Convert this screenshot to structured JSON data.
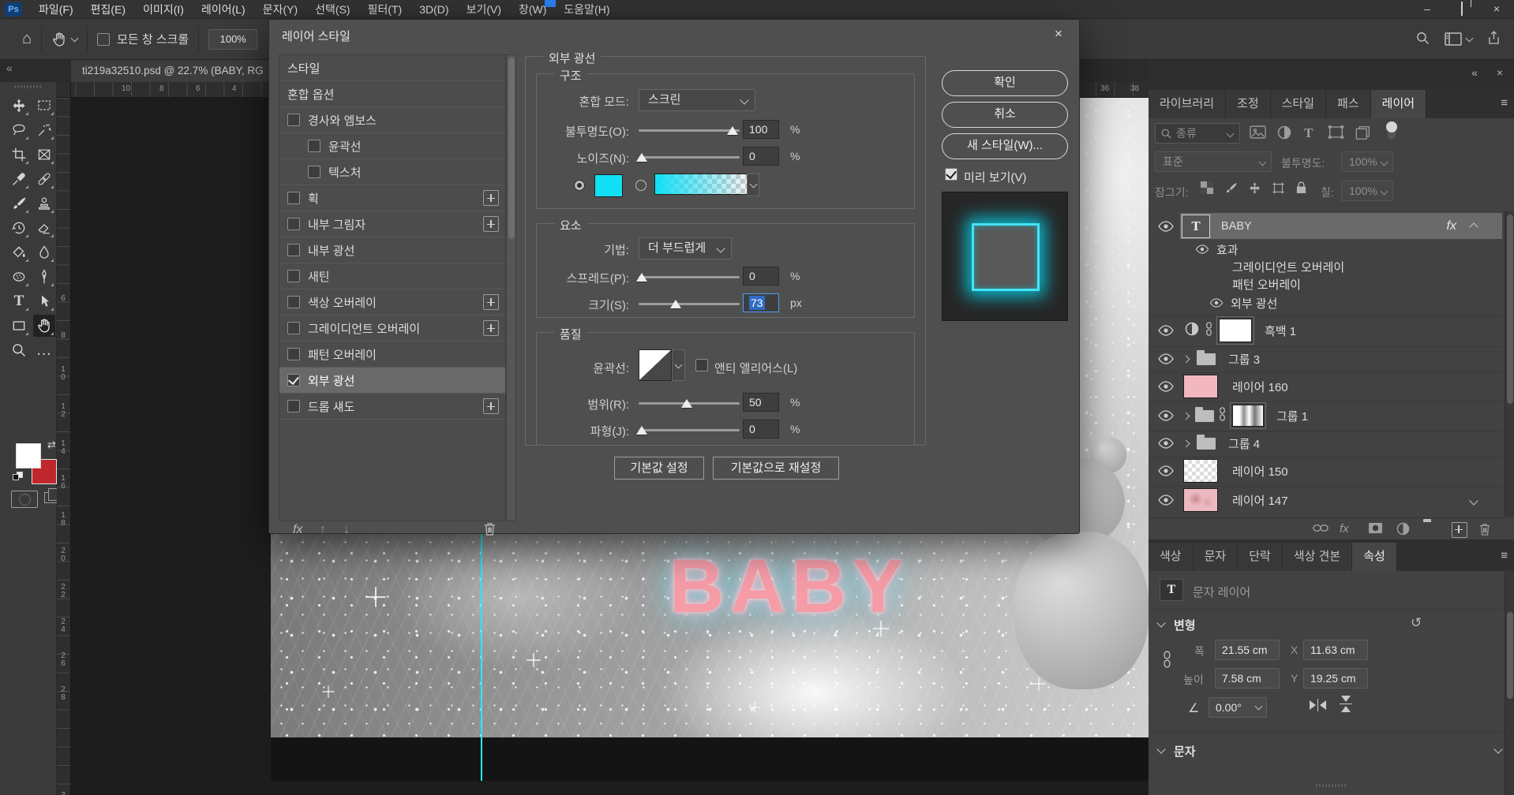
{
  "chrome": {
    "logo": "Ps",
    "menus": [
      "파일(F)",
      "편집(E)",
      "이미지(I)",
      "레이어(L)",
      "문자(Y)",
      "선택(S)",
      "필터(T)",
      "3D(D)",
      "보기(V)",
      "창(W)",
      "도움말(H)"
    ]
  },
  "glyphs": {
    "home": "⌂",
    "swap": "⇄",
    "reset": "↺",
    "angle": "∠",
    "more": "…",
    "collapse_left": "«",
    "hamburger": "≡",
    "minimize": "–",
    "close": "×",
    "up_arrow": "↑",
    "down_arrow": "↓"
  },
  "options_bar": {
    "scroll_all_windows_label": "모든 창 스크롤",
    "zoom_value": "100%"
  },
  "tab_bar": {
    "doc_title": "ti219a32510.psd @ 22.7% (BABY, RG"
  },
  "rulers": {
    "h": [
      "10",
      "8",
      "6",
      "4",
      "36",
      "38"
    ],
    "v": [
      "6",
      "8",
      "10",
      "12",
      "14",
      "16",
      "18",
      "20",
      "22",
      "24",
      "26",
      "28",
      "3"
    ]
  },
  "canvas": {
    "text": "BABY"
  },
  "dialog": {
    "title": "레이어 스타일",
    "list": {
      "header": "스타일",
      "blending": "혼합 옵션",
      "items": [
        {
          "label": "경사와 엠보스"
        },
        {
          "label": "윤곽선"
        },
        {
          "label": "텍스처"
        },
        {
          "label": "획"
        },
        {
          "label": "내부 그림자"
        },
        {
          "label": "내부 광선"
        },
        {
          "label": "새틴"
        },
        {
          "label": "색상 오버레이"
        },
        {
          "label": "그레이디언트 오버레이"
        },
        {
          "label": "패턴 오버레이"
        },
        {
          "label": "외부 광선"
        },
        {
          "label": "드롭 섀도"
        }
      ]
    },
    "fx_label": "fx",
    "section_title": "외부 광선",
    "structure": {
      "legend": "구조",
      "blend_mode_label": "혼합 모드:",
      "blend_mode_value": "스크린",
      "opacity_label": "불투명도(O):",
      "opacity_value": "100",
      "noise_label": "노이즈(N):",
      "noise_value": "0"
    },
    "elements": {
      "legend": "요소",
      "technique_label": "기법:",
      "technique_value": "더 부드럽게",
      "spread_label": "스프레드(P):",
      "spread_value": "0",
      "size_label": "크기(S):",
      "size_value": "73"
    },
    "quality": {
      "legend": "품질",
      "contour_label": "윤곽선:",
      "antialias_label": "앤티 앨리어스(L)",
      "range_label": "범위(R):",
      "range_value": "50",
      "jitter_label": "파형(J):",
      "jitter_value": "0"
    },
    "units": {
      "percent": "%",
      "px": "px"
    },
    "ok": "확인",
    "cancel": "취소",
    "new_style": "새 스타일(W)...",
    "preview_label": "미리 보기(V)",
    "set_defaults": "기본값 설정",
    "reset_defaults": "기본값으로 재설정"
  },
  "panels": {
    "tabs_top": [
      "라이브러리",
      "조정",
      "스타일",
      "패스",
      "레이어"
    ],
    "filter_kind": "종류",
    "blend_mode": "표준",
    "opacity_label": "불투명도:",
    "opacity_value": "100%",
    "lock_label": "잠그기:",
    "fill_label": "칠:",
    "fill_value": "100%",
    "layers": {
      "baby": "BABY",
      "effects": "효과",
      "fx1": "그레이디언트 오버레이",
      "fx2": "패턴 오버레이",
      "fx3": "외부 광선",
      "bw": "흑백 1",
      "g3": "그룹 3",
      "l160": "레이어 160",
      "g1": "그룹 1",
      "g4": "그룹 4",
      "l150": "레이어 150",
      "l147": "레이어 147",
      "fx_badge": "fx"
    },
    "tabs_bottom": [
      "색상",
      "문자",
      "단락",
      "색상 견본",
      "속성"
    ],
    "properties": {
      "type_label": "문자 레이어",
      "transform": "변형",
      "w_label": "폭",
      "w": "21.55 cm",
      "x_label": "X",
      "x": "11.63 cm",
      "h_label": "높이",
      "h": "7.58 cm",
      "y_label": "Y",
      "y": "19.25 cm",
      "angle": "0.00°",
      "character": "문자"
    }
  },
  "colors": {
    "accent_cyan": "#10e0f6",
    "baby_pink": "#f59ca7",
    "foreground": "#ffffff",
    "background_swatch": "#c0272d"
  }
}
